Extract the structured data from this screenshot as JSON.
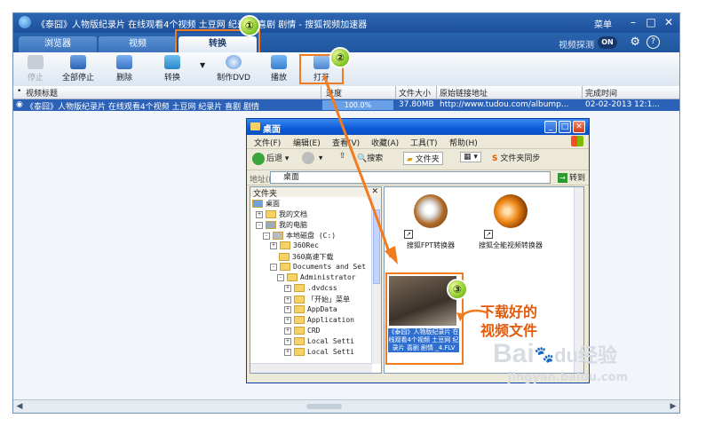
{
  "app": {
    "title": "《泰囧》人物版纪录片 在线观看4个视频 土豆网 纪录片 喜剧 剧情 - 搜狐视频加速器",
    "menu_label": "菜单",
    "window_buttons": [
      "minimize-icon",
      "maximize-icon",
      "close-icon"
    ]
  },
  "tabs": [
    {
      "label": "浏览器"
    },
    {
      "label": "视频"
    },
    {
      "label": "转换",
      "active": true
    }
  ],
  "tabbar_right": {
    "label": "视频探测",
    "toggle": "ON"
  },
  "toolbar": {
    "items": [
      {
        "label": "停止",
        "enabled": false,
        "icon": "stop-icon"
      },
      {
        "label": "全部停止",
        "enabled": true,
        "icon": "stop-all-icon"
      },
      {
        "label": "删除",
        "enabled": true,
        "icon": "delete-icon"
      },
      {
        "label": "转换",
        "enabled": true,
        "icon": "convert-icon"
      },
      {
        "label": "制作DVD",
        "enabled": true,
        "icon": "dvd-icon"
      },
      {
        "label": "播放",
        "enabled": true,
        "icon": "play-icon"
      },
      {
        "label": "打开",
        "enabled": true,
        "icon": "open-icon"
      }
    ]
  },
  "table": {
    "headers": [
      "视频标题",
      "进度",
      "文件大小",
      "原始链接地址",
      "完成时间"
    ],
    "rows": [
      {
        "title": "《泰囧》人物版纪录片 在线观看4个视频 土豆网 纪录片 喜剧 剧情",
        "progress": 100,
        "progress_text": "100.0%",
        "size": "37.80MB",
        "url": "http://www.tudou.com/albump...",
        "completed": "02-02-2013 12:1..."
      }
    ]
  },
  "explorer": {
    "title": "桌面",
    "menu": [
      "文件(F)",
      "编辑(E)",
      "查看(V)",
      "收藏(A)",
      "工具(T)",
      "帮助(H)"
    ],
    "toolbar": {
      "back": "后退",
      "search": "搜索",
      "folders": "文件夹",
      "sync": "文件夹同步"
    },
    "address_label": "地址(D)",
    "address_value": "桌面",
    "go_label": "转到",
    "pane_title": "文件夹",
    "tree": [
      "桌面",
      "我的文档",
      "我的电脑",
      "本地磁盘 (C:)",
      "360Rec",
      "360高速下载",
      "Documents and Set",
      "Administrator",
      ".dvdcss",
      "「开始」菜单",
      "AppData",
      "Application",
      "CRD",
      "Local Setti",
      "Local Setti"
    ],
    "files": [
      {
        "label": "搜狐FPT转换器",
        "icon": "converter-app-icon"
      },
      {
        "label": "搜狐全能视频转换器",
        "icon": "video-converter-app-icon"
      }
    ],
    "video_file_caption": "《泰囧》人物版纪录片 在线观看4个视频 土豆网 纪录片 喜剧 剧情 _4.FLV"
  },
  "annotations": {
    "badges": [
      "①",
      "②",
      "③"
    ],
    "note_line1": "下载好的",
    "note_line2": "视频文件",
    "arrow_color": "#f27a1f"
  },
  "watermark": {
    "brand": "Bai",
    "brand2": "du",
    "suffix": "经验",
    "url": "jingyan.baidu.com"
  },
  "colors": {
    "accent": "#2b62b8",
    "highlight": "#f27a1f",
    "annotation_text": "#e25a0a"
  }
}
